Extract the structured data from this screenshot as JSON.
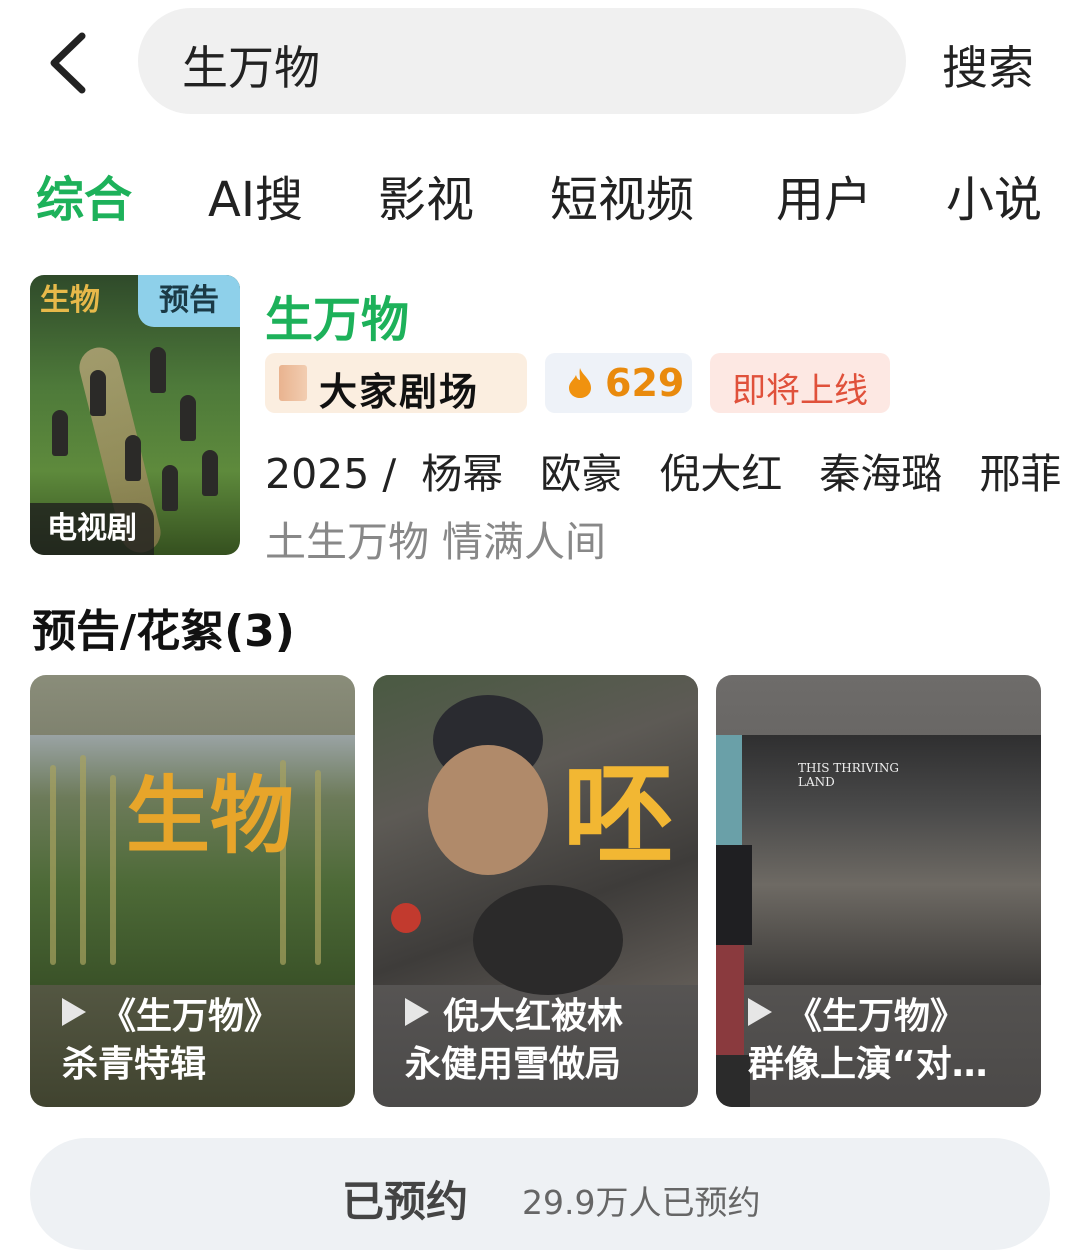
{
  "header": {
    "search_value": "生万物",
    "search_button": "搜索"
  },
  "tabs": [
    {
      "label": "综合",
      "active": true
    },
    {
      "label": "AI搜",
      "active": false
    },
    {
      "label": "影视",
      "active": false
    },
    {
      "label": "短视频",
      "active": false
    },
    {
      "label": "用户",
      "active": false
    },
    {
      "label": "小说",
      "active": false
    }
  ],
  "result": {
    "title": "生万物",
    "poster_badge_top": "预告",
    "poster_badge_bottom": "电视剧",
    "poster_logo": "生物",
    "theatre_label": "大家剧场",
    "heat": "629",
    "status": "即将上线",
    "year": "2025 /",
    "cast": [
      "杨幂",
      "欧豪",
      "倪大红",
      "秦海璐",
      "邢菲"
    ],
    "tagline": "土生万物 情满人间"
  },
  "section": {
    "title": "预告/花絮(3)"
  },
  "videos": [
    {
      "line1": "《生万物》",
      "line2": "杀青特辑",
      "thumb_text": "生物"
    },
    {
      "line1": "倪大红被林",
      "line2": "永健用雪做局",
      "thumb_text": "呸"
    },
    {
      "line1": "《生万物》",
      "line2": "群像上演“对…",
      "thumb_text": "THIS THRIVING LAND"
    }
  ],
  "reserve": {
    "label": "已预约",
    "count": "29.9万人已预约"
  },
  "colors": {
    "accent_green": "#1db15a",
    "heat_orange": "#e98a0d",
    "status_red": "#e0513b"
  },
  "icons": [
    "back-arrow-icon",
    "fire-icon",
    "play-icon",
    "theatre-book-icon"
  ]
}
